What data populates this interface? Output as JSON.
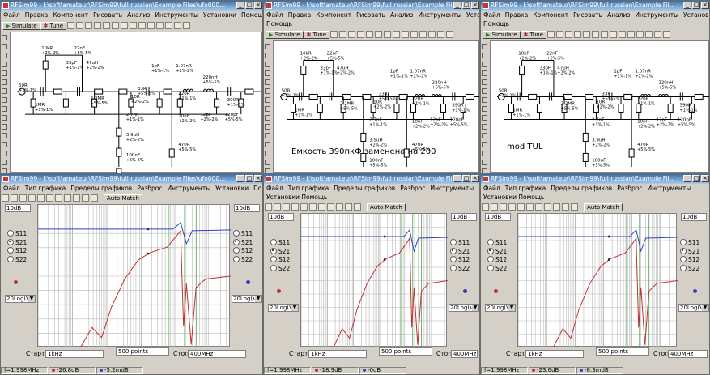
{
  "colors": {
    "s11": "#3040c0",
    "s21": "#c03030",
    "grid": "#b8b8b8",
    "titlebar": "#3a6ea5",
    "accent": "#208020"
  },
  "windows": [
    {
      "title": "RFSim99 - I:\\soft\\amateur\\RFSim99\\full russian\\Example Files\\ufo000...",
      "menu": [
        "Файл",
        "Правка",
        "Компонент",
        "Рисовать",
        "Анализ",
        "Инструменты",
        "Установки",
        "Помощь"
      ],
      "menu_row2": "",
      "simulate_label": "Simulate",
      "tune_label": "Tune",
      "note": "",
      "graph": {
        "title": "RFSim99 - I:\\soft\\amateur\\RFSim99\\full russian\\Example Files\\ufo000...",
        "menu": [
          "Файл",
          "Тип графика",
          "Пределы графиков",
          "Разброс",
          "Инструменты",
          "Установки",
          "Помощь"
        ],
        "menu_row2": "",
        "auto_match_label": "Auto Match",
        "scale_left": "10dB",
        "scale_right": "10dB",
        "params": [
          "S11",
          "S21",
          "S12",
          "S22"
        ],
        "selected_param": "S21",
        "format": "20Log(V)",
        "start_label": "Старт",
        "start_value": "1kHz",
        "points": "500 points",
        "stop_label": "Стоп",
        "stop_value": "400MHz",
        "status_freq": "f=1.998MHz",
        "status_s21": "-26.8dB",
        "status_s11": "-5.2mdB"
      }
    },
    {
      "title": "RFSim99 - I:\\soft\\amateur\\RFSim99\\full russian\\Example Files\\...",
      "menu": [
        "Файл",
        "Правка",
        "Компонент",
        "Рисовать",
        "Анализ",
        "Инструменты",
        "Установки"
      ],
      "menu_row2": "Помощь",
      "simulate_label": "Simulate",
      "tune_label": "Tune",
      "note": "Емкость 390пкФ заменена на 200",
      "graph": {
        "title": "RFSim99 - I:\\soft\\amateur\\RFSim99\\full russian\\Example Files\\...",
        "menu": [
          "Файл",
          "Тип графика",
          "Пределы графиков",
          "Разброс",
          "Инструменты"
        ],
        "menu_row2": "Установки  Помощь",
        "auto_match_label": "Auto Match",
        "scale_left": "10dB",
        "scale_right": "10dB",
        "params": [
          "S11",
          "S21",
          "S12",
          "S22"
        ],
        "selected_param": "S21",
        "format": "20Log(V)",
        "start_label": "Старт",
        "start_value": "1kHz",
        "points": "500 points",
        "stop_label": "Стоп",
        "stop_value": "400MHz",
        "status_freq": "f=1.998MHz",
        "status_s21": "-18.9dB",
        "status_s11": "-0dB"
      }
    },
    {
      "title": "RFSim99 - I:\\soft\\amateur\\RFSim99\\full russian\\Example Fil...",
      "menu": [
        "Файл",
        "Правка",
        "Компонент",
        "Рисовать",
        "Анализ",
        "Инструменты",
        "Установки"
      ],
      "menu_row2": "Помощь",
      "simulate_label": "Simulate",
      "tune_label": "Tune",
      "note": "mod TUL",
      "graph": {
        "title": "RFSim99 - I:\\soft\\amateur\\RFSim99\\full russian\\Example Fil...",
        "menu": [
          "Файл",
          "Тип графика",
          "Пределы графиков",
          "Разброс",
          "Инструменты"
        ],
        "menu_row2": "Установки  Помощь",
        "auto_match_label": "Auto Match",
        "scale_left": "10dB",
        "scale_right": "10dB",
        "params": [
          "S11",
          "S21",
          "S12",
          "S22"
        ],
        "selected_param": "S21",
        "format": "20Log(V)",
        "start_label": "Старт",
        "start_value": "1kHz",
        "points": "500 points",
        "stop_label": "Стоп",
        "stop_value": "400MHz",
        "status_freq": "f=1.998MHz",
        "status_s21": "-23.6dB",
        "status_s11": "-8.3mdB"
      }
    }
  ],
  "schematic_labels": [
    "50R",
    "10kR",
    "22nF",
    "33pF",
    "47uH",
    "2.2MR",
    "1MR",
    "10R",
    "33R",
    "2.7nF",
    "3.9uH",
    "100nF",
    "1pF",
    "1.07nR",
    "220nH",
    "220R",
    "12pF",
    "120pF",
    "390R",
    "10nF",
    "470R",
    "+1%-1%",
    "+2%-2%",
    "+5%-5%"
  ]
}
